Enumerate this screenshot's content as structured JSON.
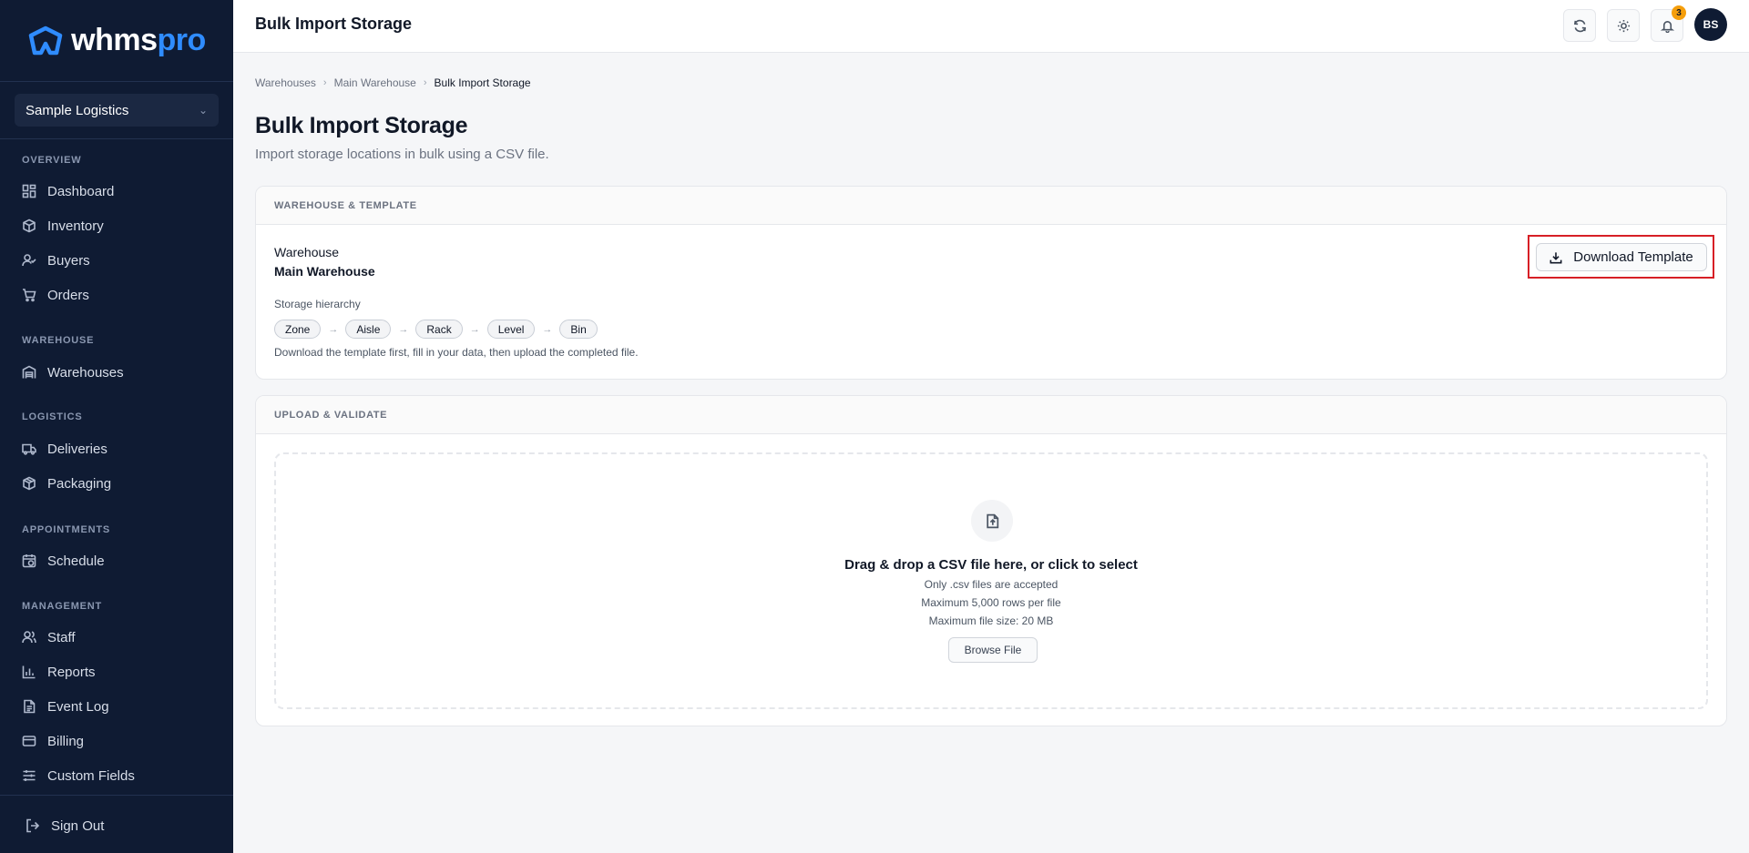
{
  "app": {
    "logo_main": "whms",
    "logo_accent": "pro",
    "org_name": "Sample Logistics"
  },
  "sidebar": {
    "sections": [
      {
        "label": "OVERVIEW",
        "items": [
          "Dashboard",
          "Inventory",
          "Buyers",
          "Orders"
        ]
      },
      {
        "label": "WAREHOUSE",
        "items": [
          "Warehouses"
        ]
      },
      {
        "label": "LOGISTICS",
        "items": [
          "Deliveries",
          "Packaging"
        ]
      },
      {
        "label": "APPOINTMENTS",
        "items": [
          "Schedule"
        ]
      },
      {
        "label": "MANAGEMENT",
        "items": [
          "Staff",
          "Reports",
          "Event Log",
          "Billing",
          "Custom Fields"
        ]
      }
    ],
    "sign_out": "Sign Out"
  },
  "header": {
    "title": "Bulk Import Storage",
    "notification_count": "3",
    "avatar_initials": "BS"
  },
  "breadcrumb": [
    "Warehouses",
    "Main Warehouse",
    "Bulk Import Storage"
  ],
  "page": {
    "title": "Bulk Import Storage",
    "subtitle": "Import storage locations in bulk using a CSV file."
  },
  "template_card": {
    "header": "WAREHOUSE & TEMPLATE",
    "warehouse_label": "Warehouse",
    "warehouse_value": "Main Warehouse",
    "hierarchy_label": "Storage hierarchy",
    "hierarchy": [
      "Zone",
      "Aisle",
      "Rack",
      "Level",
      "Bin"
    ],
    "hint": "Download the template first, fill in your data, then upload the completed file.",
    "download_button": "Download Template"
  },
  "upload_card": {
    "header": "UPLOAD & VALIDATE",
    "title": "Drag & drop a CSV file here, or click to select",
    "lines": [
      "Only .csv files are accepted",
      "Maximum 5,000 rows per file",
      "Maximum file size: 20 MB"
    ],
    "browse_button": "Browse File"
  },
  "colors": {
    "sidebar_bg": "#0f1b33",
    "brand_accent": "#2f8cff",
    "badge": "#f59e0b",
    "highlight": "#d71f26"
  }
}
